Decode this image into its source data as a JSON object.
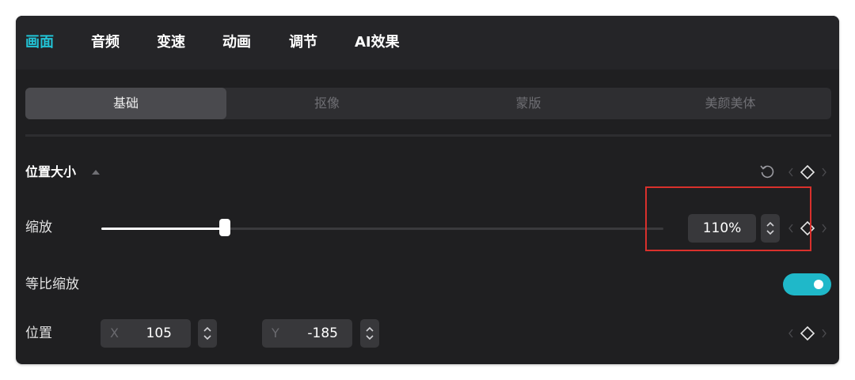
{
  "top_tabs": [
    {
      "label": "画面",
      "active": true
    },
    {
      "label": "音频",
      "active": false
    },
    {
      "label": "变速",
      "active": false
    },
    {
      "label": "动画",
      "active": false
    },
    {
      "label": "调节",
      "active": false
    },
    {
      "label": "AI效果",
      "active": false
    }
  ],
  "sub_tabs": [
    {
      "label": "基础",
      "active": true
    },
    {
      "label": "抠像",
      "active": false
    },
    {
      "label": "蒙版",
      "active": false
    },
    {
      "label": "美颜美体",
      "active": false
    }
  ],
  "section": {
    "title": "位置大小"
  },
  "scale": {
    "label": "缩放",
    "value": "110%",
    "slider_fraction": 0.22
  },
  "uniform_scale": {
    "label": "等比缩放",
    "enabled": true
  },
  "position": {
    "label": "位置",
    "x_label": "X",
    "x_value": "105",
    "y_label": "Y",
    "y_value": "-185"
  },
  "colors": {
    "accent": "#22c3d6",
    "toggle_on": "#1fb8c9",
    "highlight": "#d9302c"
  },
  "icons": [
    "reset-icon",
    "keyframe-diamond-icon",
    "chevron-left-icon",
    "chevron-right-icon",
    "caret-up-icon",
    "stepper-icon"
  ]
}
